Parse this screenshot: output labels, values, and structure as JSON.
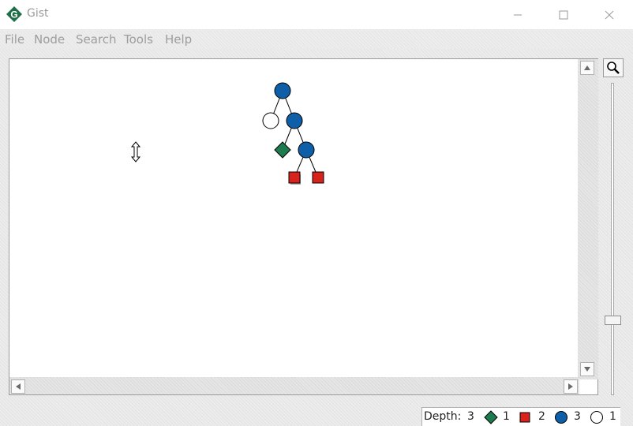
{
  "window": {
    "title": "Gist",
    "controls": [
      "minimize",
      "maximize",
      "close"
    ]
  },
  "menu": {
    "items": [
      "File",
      "Node",
      "Search",
      "Tools",
      "Help"
    ]
  },
  "tree": {
    "nodes": [
      {
        "id": "n1",
        "kind": "choice",
        "color": "#0f5fa8",
        "parent": null
      },
      {
        "id": "n2",
        "kind": "unexplored",
        "color": "#ffffff",
        "parent": "n1"
      },
      {
        "id": "n3",
        "kind": "choice",
        "color": "#0f5fa8",
        "parent": "n1"
      },
      {
        "id": "n4",
        "kind": "solution",
        "color": "#1e7a4f",
        "parent": "n3"
      },
      {
        "id": "n5",
        "kind": "choice",
        "color": "#0f5fa8",
        "parent": "n3"
      },
      {
        "id": "n6",
        "kind": "failure",
        "color": "#d8231c",
        "parent": "n5",
        "selected": true
      },
      {
        "id": "n7",
        "kind": "failure",
        "color": "#d8231c",
        "parent": "n5"
      }
    ]
  },
  "status": {
    "depth_label": "Depth:",
    "depth_value": "3",
    "solutions_count": "1",
    "failures_count": "2",
    "choices_count": "3",
    "open_count": "1",
    "colors": {
      "solution": "#1e7a4f",
      "failure": "#d8231c",
      "choice": "#0f5fa8",
      "open": "#ffffff"
    }
  },
  "icons": {
    "app": "gist-logo-icon",
    "zoom": "magnifier-icon",
    "cursor": "resize-vertical-cursor-icon"
  }
}
